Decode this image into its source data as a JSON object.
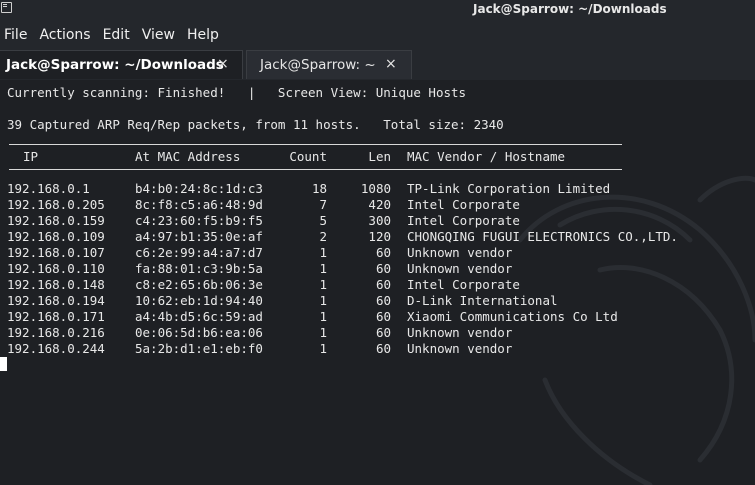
{
  "window": {
    "title": "Jack@Sparrow: ~/Downloads"
  },
  "menu": {
    "items": [
      "File",
      "Actions",
      "Edit",
      "View",
      "Help"
    ]
  },
  "tabs": [
    {
      "label": "Jack@Sparrow: ~/Downloads",
      "close": "×",
      "active": true
    },
    {
      "label": "Jack@Sparrow: ~",
      "close": "×",
      "active": false
    }
  ],
  "terminal": {
    "status_line": "Currently scanning: Finished!   |   Screen View: Unique Hosts",
    "summary_line": "39 Captured ARP Req/Rep packets, from 11 hosts.   Total size: 2340",
    "columns": {
      "ip": "IP",
      "mac": "At MAC Address",
      "count": "Count",
      "len": "Len",
      "vendor": "MAC Vendor / Hostname"
    },
    "rows": [
      {
        "ip": "192.168.0.1",
        "mac": "b4:b0:24:8c:1d:c3",
        "count": "18",
        "len": "1080",
        "vendor": "TP-Link Corporation Limited"
      },
      {
        "ip": "192.168.0.205",
        "mac": "8c:f8:c5:a6:48:9d",
        "count": "7",
        "len": "420",
        "vendor": "Intel Corporate"
      },
      {
        "ip": "192.168.0.159",
        "mac": "c4:23:60:f5:b9:f5",
        "count": "5",
        "len": "300",
        "vendor": "Intel Corporate"
      },
      {
        "ip": "192.168.0.109",
        "mac": "a4:97:b1:35:0e:af",
        "count": "2",
        "len": "120",
        "vendor": "CHONGQING FUGUI ELECTRONICS CO.,LTD."
      },
      {
        "ip": "192.168.0.107",
        "mac": "c6:2e:99:a4:a7:d7",
        "count": "1",
        "len": "60",
        "vendor": "Unknown vendor"
      },
      {
        "ip": "192.168.0.110",
        "mac": "fa:88:01:c3:9b:5a",
        "count": "1",
        "len": "60",
        "vendor": "Unknown vendor"
      },
      {
        "ip": "192.168.0.148",
        "mac": "c8:e2:65:6b:06:3e",
        "count": "1",
        "len": "60",
        "vendor": "Intel Corporate"
      },
      {
        "ip": "192.168.0.194",
        "mac": "10:62:eb:1d:94:40",
        "count": "1",
        "len": "60",
        "vendor": "D-Link International"
      },
      {
        "ip": "192.168.0.171",
        "mac": "a4:4b:d5:6c:59:ad",
        "count": "1",
        "len": "60",
        "vendor": "Xiaomi Communications Co Ltd"
      },
      {
        "ip": "192.168.0.216",
        "mac": "0e:06:5d:b6:ea:06",
        "count": "1",
        "len": "60",
        "vendor": "Unknown vendor"
      },
      {
        "ip": "192.168.0.244",
        "mac": "5a:2b:d1:e1:eb:f0",
        "count": "1",
        "len": "60",
        "vendor": "Unknown vendor"
      }
    ]
  },
  "colors": {
    "chrome_bg": "#24272c",
    "terminal_bg": "#1e2024",
    "text": "#e8e8e8"
  }
}
